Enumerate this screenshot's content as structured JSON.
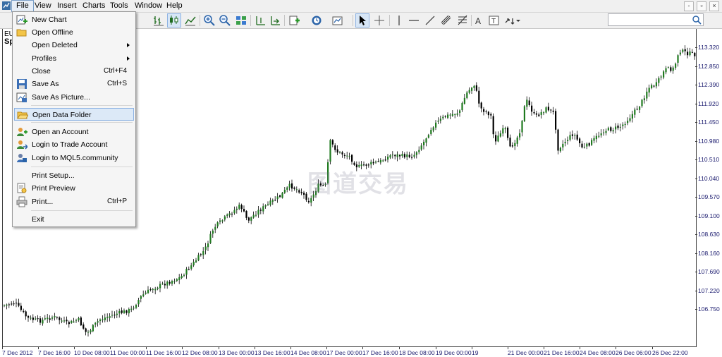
{
  "menubar": {
    "items": [
      "File",
      "View",
      "Insert",
      "Charts",
      "Tools",
      "Window",
      "Help"
    ],
    "active": "File"
  },
  "window_controls": [
    "-",
    "▫",
    "×"
  ],
  "chart": {
    "symbol_short": "EU",
    "symbol_line2": "Sp",
    "watermark": "图道交易",
    "price_axis": [
      "113.320",
      "112.850",
      "112.390",
      "111.920",
      "111.450",
      "110.980",
      "110.510",
      "110.040",
      "109.570",
      "109.100",
      "108.630",
      "108.160",
      "107.690",
      "107.220",
      "106.750"
    ],
    "time_axis": [
      "7 Dec 2012",
      "7 Dec 16:00",
      "10 Dec 08:00",
      "11 Dec 00:00",
      "11 Dec 16:00",
      "12 Dec 08:00",
      "13 Dec 00:00",
      "13 Dec 16:00",
      "14 Dec 08:00",
      "17 Dec 00:00",
      "17 Dec 16:00",
      "18 Dec 08:00",
      "19 Dec 00:00",
      "19",
      "21 Dec 00:00",
      "21 Dec 16:00",
      "24 Dec 08:00",
      "26 Dec 06:00",
      "26 Dec 22:00"
    ]
  },
  "file_menu": {
    "new_chart": "New Chart",
    "open_offline": "Open Offline",
    "open_deleted": "Open Deleted",
    "profiles": "Profiles",
    "close": "Close",
    "close_shortcut": "Ctrl+F4",
    "save_as": "Save As",
    "save_as_shortcut": "Ctrl+S",
    "save_as_picture": "Save As Picture...",
    "open_data_folder": "Open Data Folder",
    "open_account": "Open an Account",
    "login_trade": "Login to Trade Account",
    "login_mql5": "Login to MQL5.community",
    "print_setup": "Print Setup...",
    "print_preview": "Print Preview",
    "print": "Print...",
    "print_shortcut": "Ctrl+P",
    "exit": "Exit"
  },
  "colors": {
    "bull_candle": "#1f7a1f",
    "bear_candle": "#000000",
    "axis_text": "#1a1a6e",
    "menu_highlight": "#dce9f7"
  }
}
